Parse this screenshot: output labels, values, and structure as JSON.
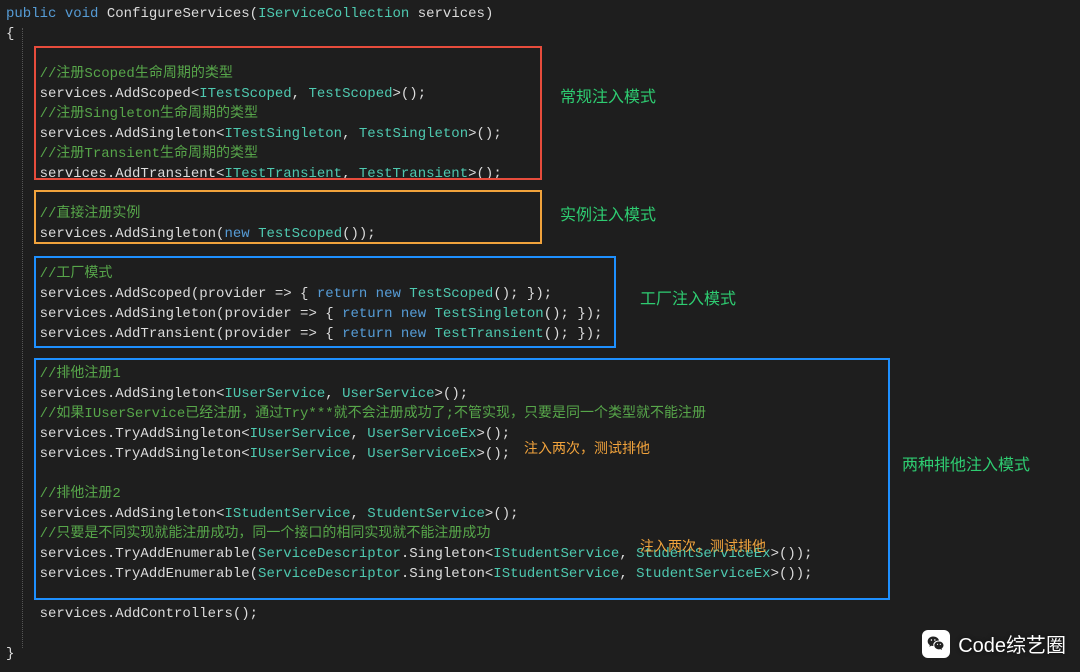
{
  "sig": {
    "public": "public",
    "void": "void",
    "name": "ConfigureServices",
    "paramType": "IServiceCollection",
    "paramName": "services"
  },
  "braceOpen": "{",
  "braceClose": "}",
  "box1": {
    "c1": "//注册Scoped生命周期的类型",
    "l1a": "services.AddScoped<",
    "l1b": "ITestScoped",
    "l1c": ", ",
    "l1d": "TestScoped",
    "l1e": ">();",
    "c2": "//注册Singleton生命周期的类型",
    "l2a": "services.AddSingleton<",
    "l2b": "ITestSingleton",
    "l2c": ", ",
    "l2d": "TestSingleton",
    "l2e": ">();",
    "c3": "//注册Transient生命周期的类型",
    "l3a": "services.AddTransient<",
    "l3b": "ITestTransient",
    "l3c": ", ",
    "l3d": "TestTransient",
    "l3e": ">();"
  },
  "box2": {
    "c1": "//直接注册实例",
    "l1a": "services.AddSingleton(",
    "l1b": "new",
    "l1c": " ",
    "l1d": "TestScoped",
    "l1e": "());"
  },
  "box3": {
    "c1": "//工厂模式",
    "l1a": "services.AddScoped(provider => { ",
    "l1r": "return",
    "l1n": " new",
    "l1t": " TestScoped",
    "l1e": "(); });",
    "l2a": "services.AddSingleton(provider => { ",
    "l2r": "return",
    "l2n": " new",
    "l2t": " TestSingleton",
    "l2e": "(); });",
    "l3a": "services.AddTransient(provider => { ",
    "l3r": "return",
    "l3n": " new",
    "l3t": " TestTransient",
    "l3e": "(); });"
  },
  "box4": {
    "c1": "//排他注册1",
    "l1a": "services.AddSingleton<",
    "l1b": "IUserService",
    "l1c": ", ",
    "l1d": "UserService",
    "l1e": ">();",
    "c2": "//如果IUserService已经注册，通过Try***就不会注册成功了;不管实现，只要是同一个类型就不能注册",
    "l2a": "services.TryAddSingleton<",
    "l2b": "IUserService",
    "l2c": ", ",
    "l2d": "UserServiceEx",
    "l2e": ">();",
    "l3a": "services.TryAddSingleton<",
    "l3b": "IUserService",
    "l3c": ", ",
    "l3d": "UserServiceEx",
    "l3e": ">();",
    "c3": "//排他注册2",
    "l4a": "services.AddSingleton<",
    "l4b": "IStudentService",
    "l4c": ", ",
    "l4d": "StudentService",
    "l4e": ">();",
    "c4": "//只要是不同实现就能注册成功，同一个接口的相同实现就不能注册成功",
    "l5a": "services.TryAddEnumerable(",
    "l5b": "ServiceDescriptor",
    "l5c": ".Singleton<",
    "l5d": "IStudentService",
    "l5e": ", ",
    "l5f": "StudentServiceEx",
    "l5g": ">());",
    "l6a": "services.TryAddEnumerable(",
    "l6b": "ServiceDescriptor",
    "l6c": ".Singleton<",
    "l6d": "IStudentService",
    "l6e": ", ",
    "l6f": "StudentServiceEx",
    "l6g": ">());"
  },
  "tail": "services.AddControllers();",
  "annots": {
    "a1": "常规注入模式",
    "a2": "实例注入模式",
    "a3": "工厂注入模式",
    "a4": "两种排他注入模式",
    "inj1": "注入两次，测试排他",
    "inj2": "注入两次，测试排他"
  },
  "watermark": "Code综艺圈"
}
